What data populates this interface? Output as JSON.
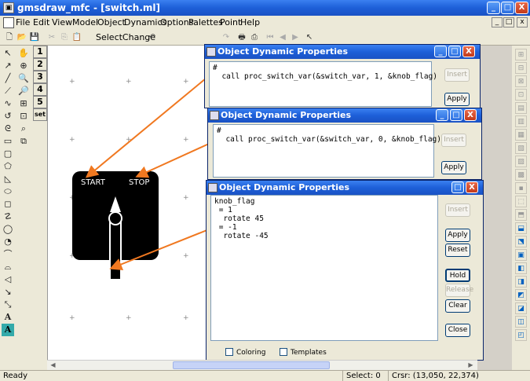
{
  "window": {
    "title": "gmsdraw_mfc - [switch.ml]",
    "controls": [
      "_",
      "□",
      "X"
    ]
  },
  "menu": {
    "items": [
      "File",
      "Edit",
      "View",
      "Model",
      "Object",
      "Dynamics",
      "Options",
      "Palettes",
      "Point",
      "Help"
    ],
    "mdi_controls": [
      "_",
      "□",
      "x"
    ]
  },
  "toolbar": {
    "select_change_label": "SelectChange"
  },
  "left_palette": {
    "number_buttons": [
      "1",
      "2",
      "3",
      "4",
      "5",
      "set"
    ]
  },
  "canvas": {
    "switch": {
      "start_label": "START",
      "stop_label": "STOP",
      "panel_color": "#000000",
      "lever_color": "#ffffff"
    }
  },
  "dialogs": [
    {
      "title": "Object Dynamic Properties",
      "code": "#\n  call proc_switch_var(&switch_var, 1, &knob_flag)",
      "buttons": [
        {
          "label": "Insert",
          "enabled": false
        },
        {
          "label": "Apply",
          "enabled": true
        }
      ]
    },
    {
      "title": "Object Dynamic Properties",
      "code": "#\n  call proc_switch_var(&switch_var, 0, &knob_flag)",
      "buttons": [
        {
          "label": "Insert",
          "enabled": false
        },
        {
          "label": "Apply",
          "enabled": true
        }
      ]
    },
    {
      "title": "Object Dynamic Properties",
      "code": "knob_flag\n = 1\n  rotate 45\n = -1\n  rotate -45",
      "buttons": [
        {
          "label": "Insert",
          "enabled": false
        },
        {
          "label": "Apply",
          "enabled": true
        },
        {
          "label": "Reset",
          "enabled": true
        },
        {
          "label": "Hold",
          "enabled": true
        },
        {
          "label": "Release",
          "enabled": false
        },
        {
          "label": "Clear",
          "enabled": true
        },
        {
          "label": "Close",
          "enabled": true
        }
      ],
      "checkboxes": [
        {
          "label": "Coloring",
          "checked": false
        },
        {
          "label": "Templates",
          "checked": false
        }
      ]
    }
  ],
  "status": {
    "message": "Ready",
    "select": "Select: 0",
    "cursor": "Crsr: (13,050, 22,374)"
  },
  "colors": {
    "arrow": "#f07820",
    "title_bar": "#1d5fd8"
  }
}
